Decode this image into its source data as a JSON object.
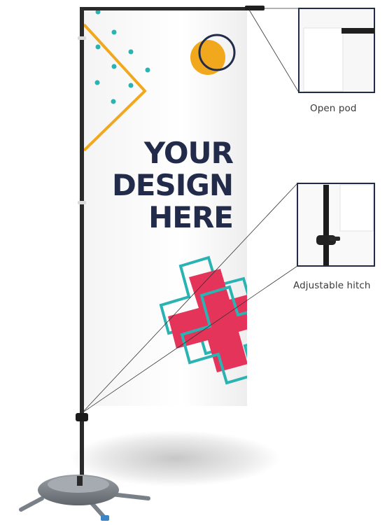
{
  "banner": {
    "headline_lines": [
      "YOUR",
      "DESIGN",
      "HERE"
    ],
    "colors": {
      "navy": "#232b4a",
      "teal": "#2bb3b3",
      "orange": "#f2a81d",
      "red": "#e5345a",
      "pole": "#2a2a2a"
    }
  },
  "callouts": {
    "open_pod": {
      "label": "Open pod"
    },
    "adjustable_hitch": {
      "label": "Adjustable hitch"
    }
  }
}
